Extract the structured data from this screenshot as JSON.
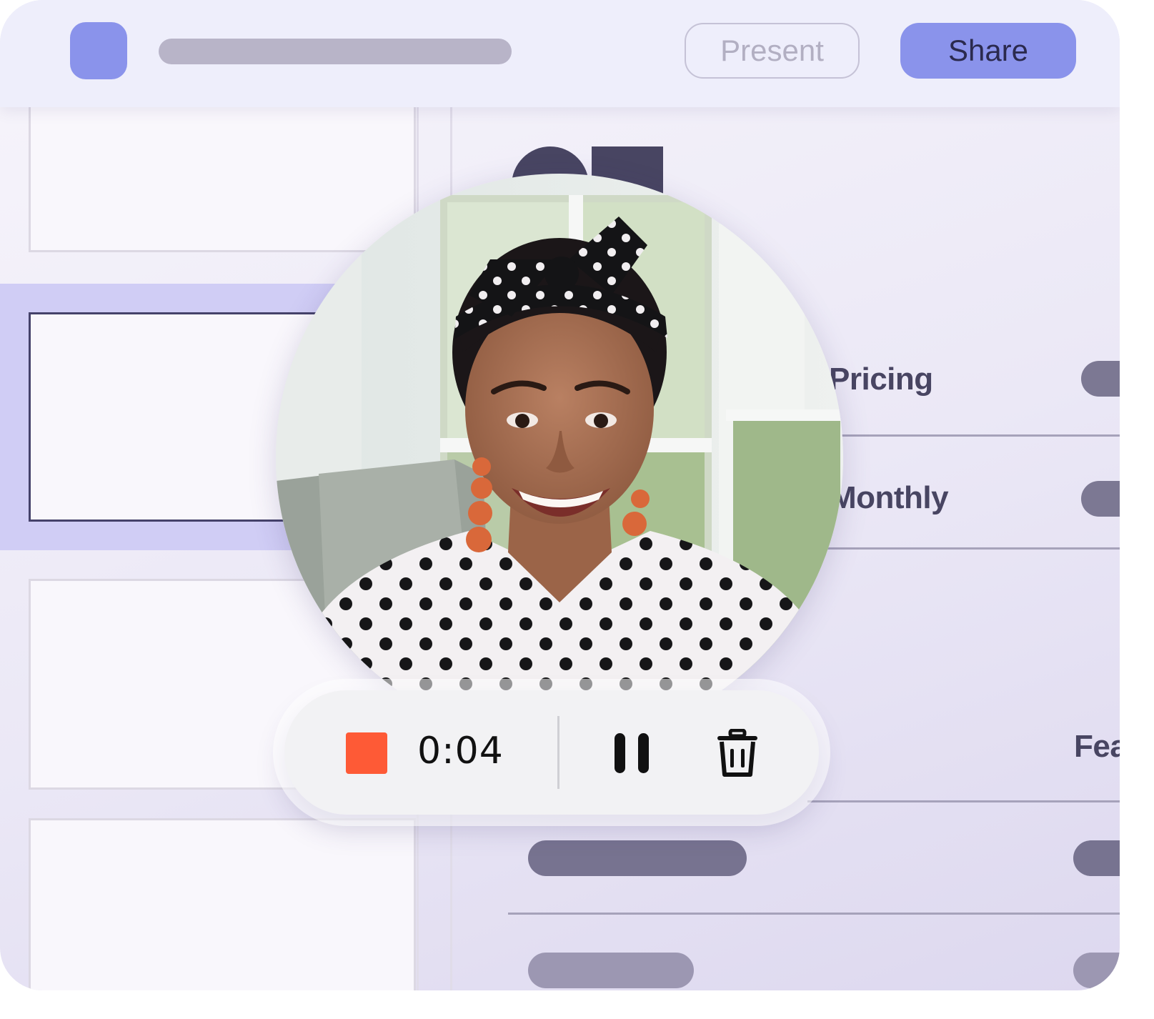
{
  "header": {
    "present_label": "Present",
    "share_label": "Share"
  },
  "table": {
    "rows": [
      {
        "label": "Pricing"
      },
      {
        "label": "Monthly"
      },
      {
        "label": "Fea"
      }
    ]
  },
  "recorder": {
    "timer": "0:04",
    "stop_icon": "stop-icon",
    "pause_icon": "pause-icon",
    "delete_icon": "trash-icon"
  },
  "colors": {
    "accent": "#8a93eb",
    "selection": "#d0cdf5",
    "record": "#fe5a36",
    "text_dark": "#484562"
  }
}
